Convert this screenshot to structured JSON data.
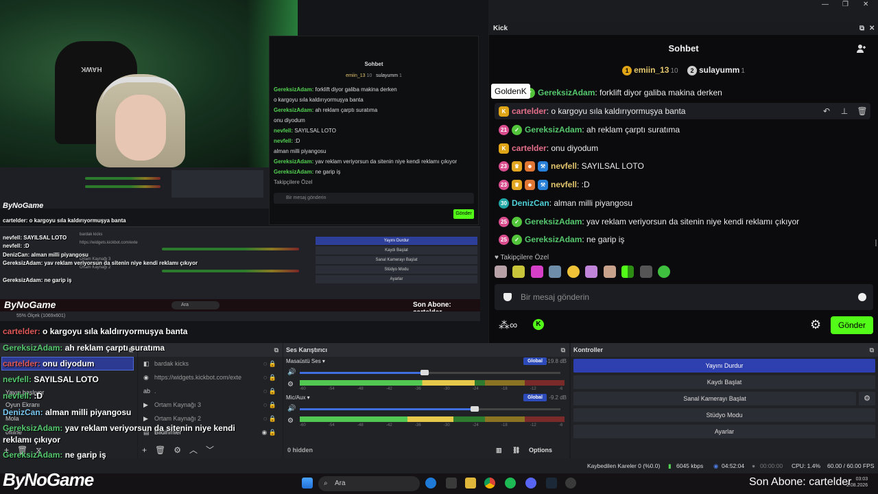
{
  "desktop": {
    "controls": [
      "—",
      "❐",
      "✕"
    ]
  },
  "capture": {
    "webcam_sign": "HAWK",
    "brand": "ByNoGame",
    "mini_chat": {
      "title": "Sohbet",
      "leader1": "emiin_13",
      "leader1_score": "10",
      "leader2": "sulayumm",
      "leader2_score": "1",
      "lines": [
        {
          "user": "GereksizAdam:",
          "text": " forklift diyor galiba makina derken"
        },
        {
          "user": "",
          "text": "o kargoyu sıla kaldırıyormuşya banta"
        },
        {
          "user": "GereksizAdam:",
          "text": " ah reklam çarptı suratıma"
        },
        {
          "user": "",
          "text": "onu diyodum"
        },
        {
          "user": "nevfell:",
          "text": " SAYILSAL LOTO"
        },
        {
          "user": "nevfell:",
          "text": " :D"
        },
        {
          "user": "",
          "text": "alman milli piyangosu"
        },
        {
          "user": "GereksizAdam:",
          "text": " yav reklam veriyorsun da sitenin niye kendi reklamı çıkıyor"
        },
        {
          "user": "GereksizAdam:",
          "text": " ne garip iş"
        }
      ],
      "followers_label": "Takipçilere Özel",
      "input_placeholder": "Bir mesaj gönderin",
      "send": "Gönder"
    },
    "mini_obs_controls": [
      "Yayını Durdur",
      "Kaydı Başlat",
      "Sanal Kamerayı Başlat",
      "Stüdyo Modu",
      "Ayarlar"
    ],
    "mini_sources": [
      "bardak kicks",
      "https://widgets.kickbot.com/exte",
      "Ortam Kaynağı 3",
      "Ortam Kaynağı 2"
    ],
    "mini_status": "55%   Ölçek (1069x601)",
    "mini_taskbar_brand": "ByNoGame",
    "mini_taskbar_search": "Ara",
    "mini_taskbar_sa": "Son Abone: cartelder",
    "overlay_lines": [
      "cartelder: o kargoyu sıla kaldırıyormuşya banta",
      "nevfell: SAYILSAL LOTO",
      "nevfell: :D",
      "DenizCan: alman milli piyangosu",
      "GereksizAdam: yav reklam veriyorsun da sitenin niye kendi reklamı çıkıyor",
      "GereksizAdam: ne garip iş"
    ],
    "big_overlay": [
      {
        "user": "cartelder:",
        "text": " o kargoyu sıla kaldırıyormuşya banta",
        "color": "red"
      },
      {
        "user": "GereksizAdam:",
        "text": " ah reklam çarptı suratıma",
        "color": "green"
      },
      {
        "user": "cartelder:",
        "text": " onu diyodum",
        "color": "red"
      },
      {
        "user": "nevfell:",
        "text": " SAYILSAL LOTO",
        "color": "green"
      },
      {
        "user": "nevfell:",
        "text": " :D",
        "color": "green"
      },
      {
        "user": "DenizCan:",
        "text": " alman milli piyangosu",
        "color": "green"
      },
      {
        "user": "GereksizAdam:",
        "text": " yav reklam veriyorsun da sitenin niye kendi",
        "color": "green"
      },
      {
        "user": "",
        "text": "reklamı çıkıyor",
        "color": "green"
      },
      {
        "user": "GereksizAdam:",
        "text": " ne garip iş",
        "color": "green"
      }
    ]
  },
  "kick": {
    "window_title": "Kick",
    "chat_title": "Sohbet",
    "leaderboard": [
      {
        "rank": "1",
        "name": "emiin_13",
        "score": "10",
        "color": "#e0a516"
      },
      {
        "rank": "2",
        "name": "sulayumm",
        "score": "1",
        "color": "#cfcfcf"
      }
    ],
    "tooltip": "GoldenK",
    "messages": [
      {
        "user": "GereksizAdam",
        "text": ": forklift diyor galiba makina derken",
        "color": "#55c86e",
        "badges": []
      },
      {
        "user": "cartelder",
        "text": ": o kargoyu sıla kaldırıyormuşya banta",
        "color": "#e56f8b",
        "badges": [
          "K"
        ]
      },
      {
        "user": "GereksizAdam",
        "text": ": ah reklam çarptı suratıma",
        "color": "#55c86e",
        "badges": [
          "21",
          "✓"
        ]
      },
      {
        "user": "cartelder",
        "text": ": onu diyodum",
        "color": "#e56f8b",
        "badges": [
          "K"
        ]
      },
      {
        "user": "nevfell",
        "text": ": SAYILSAL LOTO",
        "color": "#e3c66d",
        "badges": [
          "23",
          "♛",
          "☻",
          "⚒"
        ]
      },
      {
        "user": "nevfell",
        "text": ": :D",
        "color": "#e3c66d",
        "badges": [
          "23",
          "♛",
          "☻",
          "⚒"
        ]
      },
      {
        "user": "DenizCan",
        "text": ": alman milli piyangosu",
        "color": "#4fd1d9",
        "badges": [
          "30"
        ]
      },
      {
        "user": "GereksizAdam",
        "text": ": yav reklam veriyorsun da sitenin niye kendi reklamı çıkıyor",
        "color": "#55c86e",
        "badges": [
          "25",
          "✓"
        ]
      },
      {
        "user": "GereksizAdam",
        "text": ": ne garip iş",
        "color": "#55c86e",
        "badges": [
          "25",
          "✓"
        ]
      }
    ],
    "followers_label": "Takipçilere Özel",
    "input_placeholder": "Bir mesaj gönderin",
    "send_label": "Gönder",
    "accent": "#53fc18"
  },
  "obs": {
    "scenes": {
      "title": "",
      "items": [
        "Yayın başlıyor",
        "Oyun Ekranı",
        "Mola",
        "offline"
      ]
    },
    "sources": {
      "items": [
        {
          "name": "bardak kicks",
          "icon": "◧"
        },
        {
          "name": "https://widgets.kickbot.com/exte",
          "icon": "◉"
        },
        {
          "name": ".",
          "icon": "ab"
        },
        {
          "name": "Ortam Kaynağı 3",
          "icon": "▶"
        },
        {
          "name": "Ortam Kaynağı 2",
          "icon": "▶"
        },
        {
          "name": "Bildirimler",
          "icon": "▤"
        }
      ]
    },
    "mixer": {
      "title": "Ses Karıştırıcı",
      "channels": [
        {
          "name": "Masaüstü Ses",
          "badge": "Global",
          "db": "-19.8 dB",
          "level": 0.48
        },
        {
          "name": "Mic/Aux",
          "badge": "Global",
          "db": "-9.2 dB",
          "level": 0.67
        }
      ],
      "ticks": [
        "-60",
        "-54",
        "-48",
        "-42",
        "-36",
        "-30",
        "-24",
        "-18",
        "-12",
        "-6",
        "0"
      ],
      "hidden": "0 hidden",
      "options": "Options"
    },
    "controls": {
      "title": "Kontroller",
      "buttons": [
        "Yayını Durdur",
        "Kaydı Başlat",
        "Sanal Kamerayı Başlat",
        "Stüdyo Modu",
        "Ayarlar"
      ]
    }
  },
  "status": {
    "dropped": "Kaybedilen Kareler 0 (%0.0)",
    "bitrate": "6045 kbps",
    "stream_time": "04:52:04",
    "rec_time": "00:00:00",
    "cpu": "CPU: 1.4%",
    "fps": "60.00 / 60.00 FPS"
  },
  "taskbar": {
    "brand": "ByNoGame",
    "search": "Ara",
    "son_abone": "Son Abone: cartelder",
    "time": "03:03",
    "date": "2.08.2026"
  }
}
